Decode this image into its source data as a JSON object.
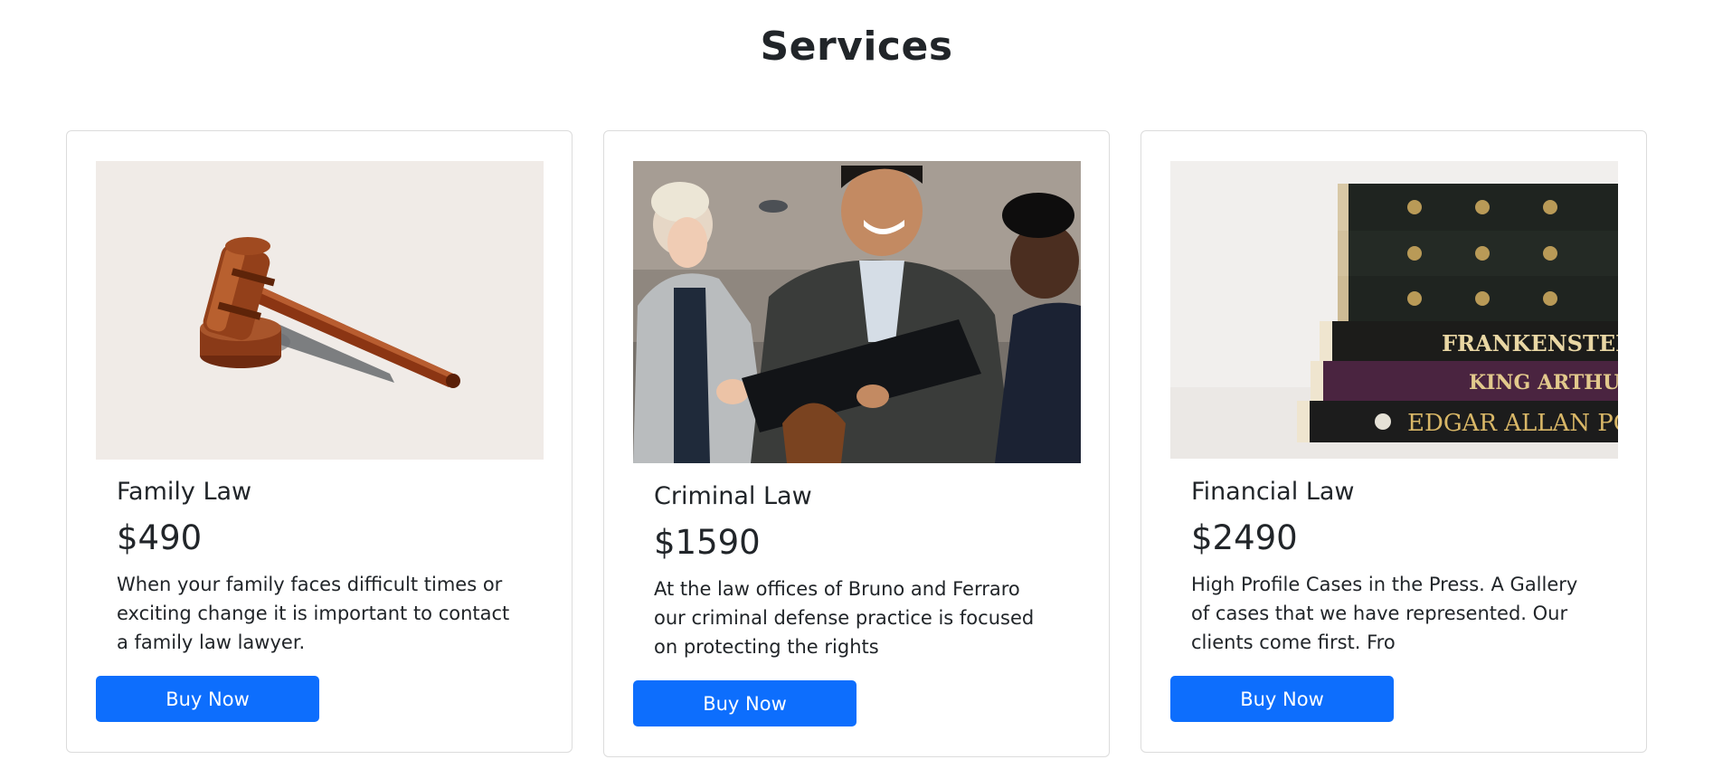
{
  "page": {
    "title": "Services"
  },
  "services": [
    {
      "title": "Family Law",
      "price": "$490",
      "description": "When your family faces difficult times or exciting change it is important to contact a family law lawyer.",
      "button_label": "Buy Now",
      "image_icon": "gavel-image"
    },
    {
      "title": "Criminal Law",
      "price": "$1590",
      "description": "At the law offices of Bruno and Ferraro our criminal defense practice is focused on protecting the rights",
      "button_label": "Buy Now",
      "image_icon": "lawyers-meeting-image"
    },
    {
      "title": "Financial Law",
      "price": "$2490",
      "description": "High Profile Cases in the Press. A Gallery of cases that we have represented. Our clients come first. Fro",
      "button_label": "Buy Now",
      "image_icon": "stacked-books-image",
      "book_spines": [
        "FRANKENSTEIN",
        "KING ARTHUR",
        "EDGAR ALLAN POE"
      ]
    }
  ],
  "colors": {
    "primary_button": "#0d6efd",
    "card_border": "#dcdcdc"
  }
}
